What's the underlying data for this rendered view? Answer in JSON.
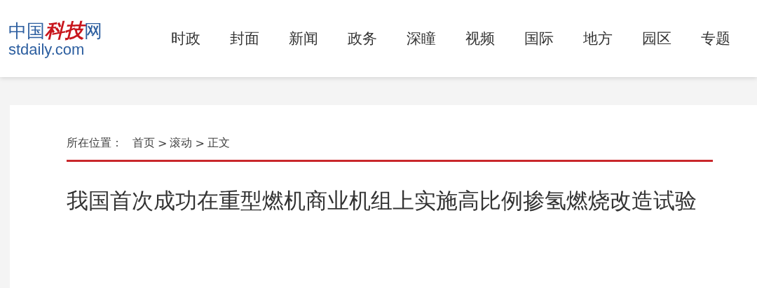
{
  "logo": {
    "title": "中国**科技**网",
    "domain": "stdaily.com"
  },
  "nav": [
    "时政",
    "封面",
    "新闻",
    "政务",
    "深瞳",
    "视频",
    "国际",
    "地方",
    "园区",
    "专题"
  ],
  "breadcrumb": {
    "label": "所在位置：",
    "items": [
      "首页",
      ">",
      "滚动",
      ">",
      "正文"
    ]
  },
  "article": {
    "title": "我国首次成功在重型燃机商业机组上实施高比例掺氢燃烧改造试验"
  }
}
